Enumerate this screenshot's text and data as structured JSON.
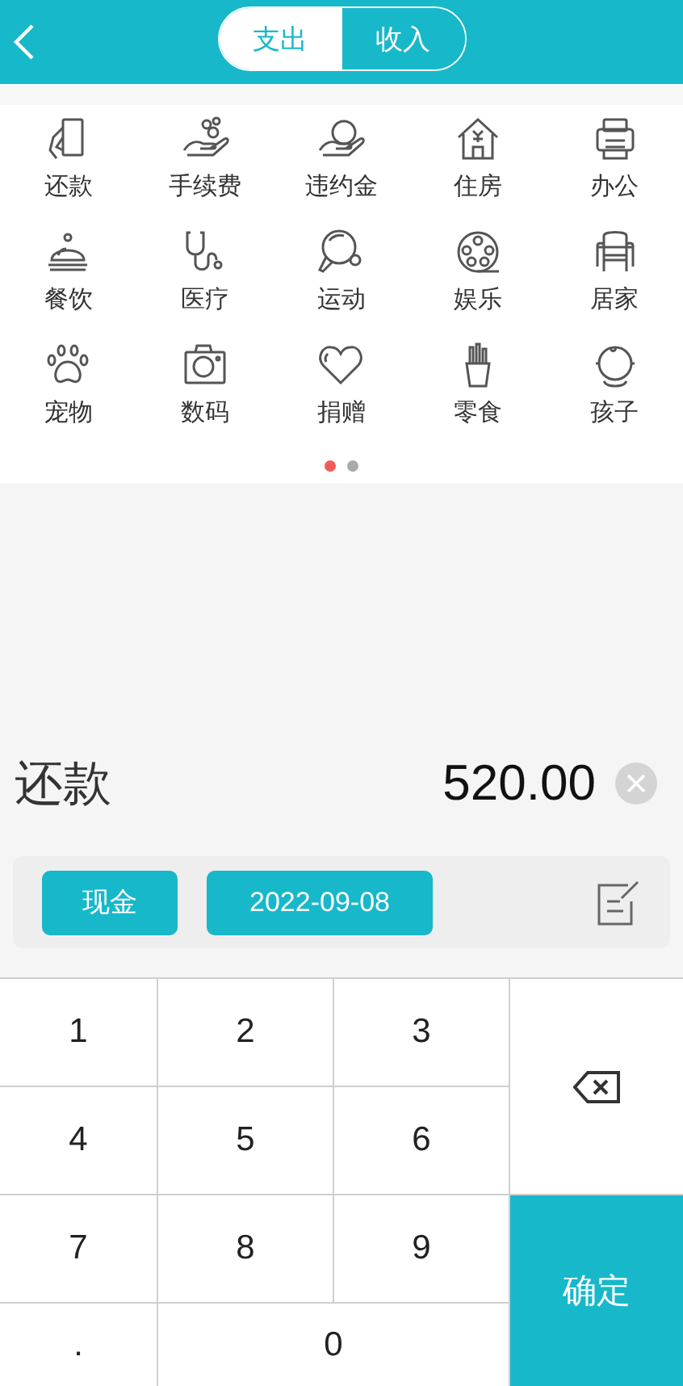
{
  "header": {
    "tabs": [
      {
        "label": "支出",
        "selected": true
      },
      {
        "label": "收入",
        "selected": false
      }
    ]
  },
  "categories": [
    {
      "label": "还款"
    },
    {
      "label": "手续费"
    },
    {
      "label": "违约金"
    },
    {
      "label": "住房"
    },
    {
      "label": "办公"
    },
    {
      "label": "餐饮"
    },
    {
      "label": "医疗"
    },
    {
      "label": "运动"
    },
    {
      "label": "娱乐"
    },
    {
      "label": "居家"
    },
    {
      "label": "宠物"
    },
    {
      "label": "数码"
    },
    {
      "label": "捐赠"
    },
    {
      "label": "零食"
    },
    {
      "label": "孩子"
    }
  ],
  "pager": [
    {
      "selected": true
    },
    {
      "selected": false
    }
  ],
  "entry": {
    "category": "还款",
    "amount": "520.00"
  },
  "options": {
    "account": "现金",
    "date": "2022-09-08"
  },
  "keypad": [
    {
      "kind": "digit",
      "label": "1"
    },
    {
      "kind": "digit",
      "label": "2"
    },
    {
      "kind": "digit",
      "label": "3"
    },
    {
      "kind": "delete"
    },
    {
      "kind": "digit",
      "label": "4"
    },
    {
      "kind": "digit",
      "label": "5"
    },
    {
      "kind": "digit",
      "label": "6"
    },
    {
      "kind": "digit",
      "label": "7"
    },
    {
      "kind": "digit",
      "label": "8"
    },
    {
      "kind": "digit",
      "label": "9"
    },
    {
      "kind": "confirm",
      "label": "确定"
    },
    {
      "kind": "digit",
      "label": "."
    },
    {
      "kind": "wide",
      "label": "0"
    }
  ]
}
